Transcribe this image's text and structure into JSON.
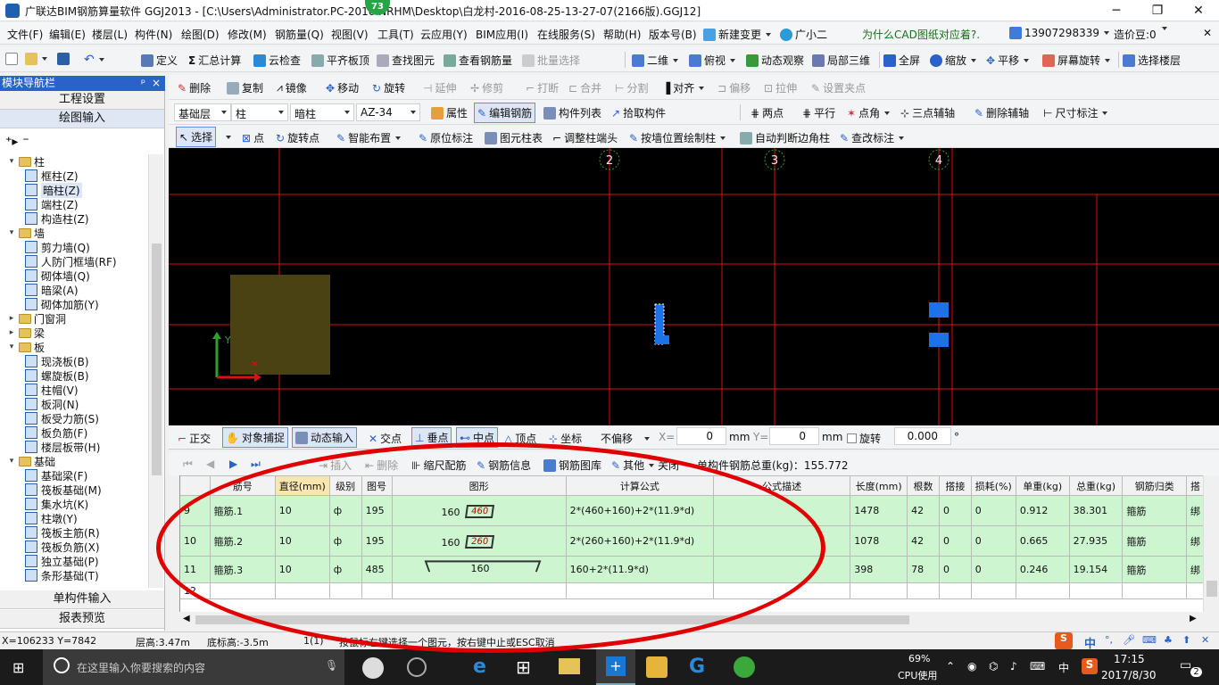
{
  "titlebar": {
    "title": "广联达BIM钢筋算量软件 GGJ2013 - [C:\\Users\\Administrator.PC-2016        NRHM\\Desktop\\白龙村-2016-08-25-13-27-07(2166版).GGJ12]",
    "badge": "73"
  },
  "menu": {
    "items": [
      "文件(F)",
      "编辑(E)",
      "楼层(L)",
      "构件(N)",
      "绘图(D)",
      "修改(M)",
      "钢筋量(Q)",
      "视图(V)",
      "工具(T)",
      "云应用(Y)",
      "BIM应用(I)",
      "在线服务(S)",
      "帮助(H)",
      "版本号(B)",
      "新建变更",
      "广小二"
    ],
    "promo": "为什么CAD图纸对应着?.",
    "phone": "13907298339",
    "coins": "造价豆:0"
  },
  "toolbar1": {
    "items": [
      "定义",
      "汇总计算",
      "云检查",
      "平齐板顶",
      "查找图元",
      "查看钢筋量",
      "批量选择",
      "二维",
      "俯视",
      "动态观察",
      "局部三维",
      "全屏",
      "缩放",
      "平移",
      "屏幕旋转",
      "选择楼层"
    ]
  },
  "toolbar2": {
    "items": [
      "删除",
      "复制",
      "镜像",
      "移动",
      "旋转",
      "延伸",
      "修剪",
      "打断",
      "合并",
      "分割",
      "对齐",
      "偏移",
      "拉伸",
      "设置夹点"
    ]
  },
  "toolbar3": {
    "floor": "基础层",
    "type": "柱",
    "subtype": "暗柱",
    "name": "AZ-34",
    "items": [
      "属性",
      "编辑钢筋",
      "构件列表",
      "拾取构件",
      "两点",
      "平行",
      "点角",
      "三点辅轴",
      "删除辅轴",
      "尺寸标注"
    ]
  },
  "toolbar4": {
    "items": [
      "选择",
      "点",
      "旋转点",
      "智能布置",
      "原位标注",
      "图元柱表",
      "调整柱端头",
      "按墙位置绘制柱",
      "自动判断边角柱",
      "查改标注"
    ]
  },
  "nav": {
    "header": "模块导航栏",
    "pin": "ᵖ",
    "close": "×",
    "project": "工程设置",
    "draw": "绘图输入",
    "single": "单构件输入",
    "report": "报表预览",
    "tree": [
      {
        "level": 0,
        "label": "柱",
        "folder": true,
        "open": true
      },
      {
        "level": 1,
        "label": "框柱(Z)"
      },
      {
        "level": 1,
        "label": "暗柱(Z)",
        "selected": true
      },
      {
        "level": 1,
        "label": "端柱(Z)"
      },
      {
        "level": 1,
        "label": "构造柱(Z)"
      },
      {
        "level": 0,
        "label": "墙",
        "folder": true,
        "open": true
      },
      {
        "level": 1,
        "label": "剪力墙(Q)"
      },
      {
        "level": 1,
        "label": "人防门框墙(RF)"
      },
      {
        "level": 1,
        "label": "砌体墙(Q)"
      },
      {
        "level": 1,
        "label": "暗梁(A)"
      },
      {
        "level": 1,
        "label": "砌体加筋(Y)"
      },
      {
        "level": 0,
        "label": "门窗洞",
        "folder": true,
        "open": false
      },
      {
        "level": 0,
        "label": "梁",
        "folder": true,
        "open": false
      },
      {
        "level": 0,
        "label": "板",
        "folder": true,
        "open": true
      },
      {
        "level": 1,
        "label": "现浇板(B)"
      },
      {
        "level": 1,
        "label": "螺旋板(B)"
      },
      {
        "level": 1,
        "label": "柱帽(V)"
      },
      {
        "level": 1,
        "label": "板洞(N)"
      },
      {
        "level": 1,
        "label": "板受力筋(S)"
      },
      {
        "level": 1,
        "label": "板负筋(F)"
      },
      {
        "level": 1,
        "label": "楼层板带(H)"
      },
      {
        "level": 0,
        "label": "基础",
        "folder": true,
        "open": true
      },
      {
        "level": 1,
        "label": "基础梁(F)"
      },
      {
        "level": 1,
        "label": "筏板基础(M)"
      },
      {
        "level": 1,
        "label": "集水坑(K)"
      },
      {
        "level": 1,
        "label": "柱墩(Y)"
      },
      {
        "level": 1,
        "label": "筏板主筋(R)"
      },
      {
        "level": 1,
        "label": "筏板负筋(X)"
      },
      {
        "level": 1,
        "label": "独立基础(P)"
      },
      {
        "level": 1,
        "label": "条形基础(T)"
      }
    ]
  },
  "canvas": {
    "axis_labels": [
      "2",
      "3",
      "4"
    ],
    "axis_y": "Y"
  },
  "snap": {
    "items": [
      "正交",
      "对象捕捉",
      "动态输入",
      "交点",
      "垂点",
      "中点",
      "顶点",
      "坐标"
    ],
    "offset": "不偏移",
    "x_label": "X=",
    "x_val": "0",
    "y_label": "Y=",
    "y_val": "0",
    "unit": "mm",
    "rotate_label": "旋转",
    "rotate_val": "0.000",
    "deg": "°"
  },
  "gridtb": {
    "items": [
      "插入",
      "删除",
      "缩尺配筋",
      "钢筋信息",
      "钢筋图库",
      "其他",
      "关闭"
    ],
    "total": "单构件钢筋总重(kg)：155.772"
  },
  "grid": {
    "headers": [
      "筋号",
      "直径(mm)",
      "级别",
      "图号",
      "图形",
      "计算公式",
      "公式描述",
      "长度(mm)",
      "根数",
      "搭接",
      "损耗(%)",
      "单重(kg)",
      "总重(kg)",
      "钢筋归类",
      "搭"
    ],
    "rows": [
      {
        "no": "9",
        "name": "箍筋.1",
        "dia": "10",
        "grade": "ф",
        "fig": "195",
        "shape_a": "160",
        "shape_b": "460",
        "formula": "2*(460+160)+2*(11.9*d)",
        "desc": "",
        "len": "1478",
        "count": "42",
        "lap": "0",
        "loss": "0",
        "unit_w": "0.912",
        "total_w": "38.301",
        "cat": "箍筋",
        "x": "绑"
      },
      {
        "no": "10",
        "name": "箍筋.2",
        "dia": "10",
        "grade": "ф",
        "fig": "195",
        "shape_a": "160",
        "shape_b": "260",
        "formula": "2*(260+160)+2*(11.9*d)",
        "desc": "",
        "len": "1078",
        "count": "42",
        "lap": "0",
        "loss": "0",
        "unit_w": "0.665",
        "total_w": "27.935",
        "cat": "箍筋",
        "x": "绑"
      },
      {
        "no": "11",
        "name": "箍筋.3",
        "dia": "10",
        "grade": "ф",
        "fig": "485",
        "shape_a": "160",
        "shape_b": "",
        "formula": "160+2*(11.9*d)",
        "desc": "",
        "len": "398",
        "count": "78",
        "lap": "0",
        "loss": "0",
        "unit_w": "0.246",
        "total_w": "19.154",
        "cat": "箍筋",
        "x": "绑"
      }
    ],
    "empty_no": "12"
  },
  "status": {
    "coords": "X=106233 Y=7842",
    "floor_h": "层高:3.47m",
    "base_h": "底标高:-3.5m",
    "layer": "1(1)",
    "hint": "按鼠标左键选择一个图元，按右键中止或ESC取消"
  },
  "ime": {
    "lang": "中"
  },
  "taskbar": {
    "search": "在这里输入你要搜索的内容",
    "cpu": "69%",
    "cpu_label": "CPU使用",
    "lang": "中",
    "time": "17:15",
    "date": "2017/8/30",
    "notif": "2"
  },
  "colors": {
    "accent": "#2a62c9",
    "row": "#ccf5d0",
    "grid": "#e00000",
    "circle": "#e00000"
  }
}
